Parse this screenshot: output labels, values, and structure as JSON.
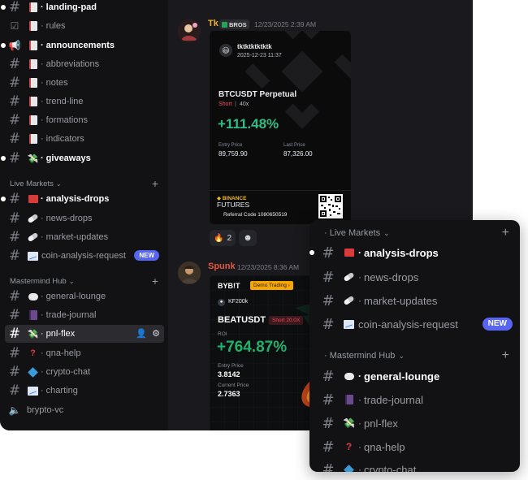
{
  "sidebar": {
    "channels": [
      {
        "emoji": "book",
        "label": "landing-pad",
        "unread": true
      },
      {
        "emoji": "book",
        "label": "rules",
        "unread": false
      },
      {
        "emoji": "book",
        "label": "announcements",
        "unread": true
      },
      {
        "emoji": "book",
        "label": "abbreviations",
        "unread": false
      },
      {
        "emoji": "book",
        "label": "notes",
        "unread": false
      },
      {
        "emoji": "book",
        "label": "trend-line",
        "unread": false
      },
      {
        "emoji": "book",
        "label": "formations",
        "unread": false
      },
      {
        "emoji": "book",
        "label": "indicators",
        "unread": false
      },
      {
        "emoji": "money",
        "label": "giveaways",
        "unread": true
      }
    ],
    "live_markets": {
      "title": "Live Markets",
      "channels": [
        {
          "label": "analysis-drops",
          "unread": true
        },
        {
          "label": "news-drops",
          "unread": false
        },
        {
          "label": "market-updates",
          "unread": false
        },
        {
          "label": "coin-analysis-request",
          "unread": false,
          "badge": "NEW"
        }
      ]
    },
    "mastermind_hub": {
      "title": "Mastermind Hub",
      "channels": [
        {
          "label": "general-lounge"
        },
        {
          "label": "trade-journal"
        },
        {
          "label": "pnl-flex"
        },
        {
          "label": "qna-help"
        },
        {
          "label": "crypto-chat"
        },
        {
          "label": "charting"
        }
      ]
    },
    "voice": {
      "label": "brypto-vc"
    }
  },
  "messages": [
    {
      "username": "Tk",
      "username_color": "#f0b232",
      "tag": "BROS",
      "timestamp": "12/23/2025 2:39 AM",
      "card": {
        "user": "tktktktktktk",
        "date": "2025-12-23 11:37",
        "symbol": "BTCUSDT Perpetual",
        "side": "Short",
        "leverage": "40x",
        "pnl": "+111.48%",
        "entry_label": "Entry Price",
        "entry": "89,759.90",
        "last_label": "Last Price",
        "last": "87,326.00",
        "brand_top": "BINANCE",
        "brand_bottom": "FUTURES",
        "referral": "Referral Code 1080650519"
      },
      "reactions": [
        {
          "emoji": "fire",
          "count": "2"
        },
        {
          "emoji": "face",
          "count": ""
        }
      ]
    },
    {
      "username": "Spunk",
      "username_color": "#e2573f",
      "timestamp": "12/23/2025 8:36 AM",
      "card": {
        "brand": "BYB!T",
        "mode": "Demo Trading",
        "user": "KF200k",
        "symbol": "BEATUSDT",
        "side": "Short 20.0X",
        "roi_label": "ROI",
        "roi": "+764.87%",
        "entry_label": "Entry Price",
        "entry": "3.8142",
        "current_label": "Current Price",
        "current": "2.7363"
      }
    }
  ],
  "panel": {
    "live_markets": {
      "title": "Live Markets",
      "channels": [
        {
          "label": "analysis-drops",
          "unread": true
        },
        {
          "label": "news-drops",
          "unread": false
        },
        {
          "label": "market-updates",
          "unread": false
        },
        {
          "label": "coin-analysis-request",
          "unread": false,
          "badge": "NEW"
        }
      ]
    },
    "mastermind_hub": {
      "title": "Mastermind Hub",
      "channels": [
        {
          "label": "general-lounge",
          "unread": true
        },
        {
          "label": "trade-journal"
        },
        {
          "label": "pnl-flex"
        },
        {
          "label": "qna-help"
        },
        {
          "label": "crypto-chat"
        }
      ]
    }
  },
  "colors": {
    "accent": "#5865f2",
    "profit": "#2ebd85",
    "binance_yellow": "#f0b90b",
    "short_red": "#f6465d"
  }
}
